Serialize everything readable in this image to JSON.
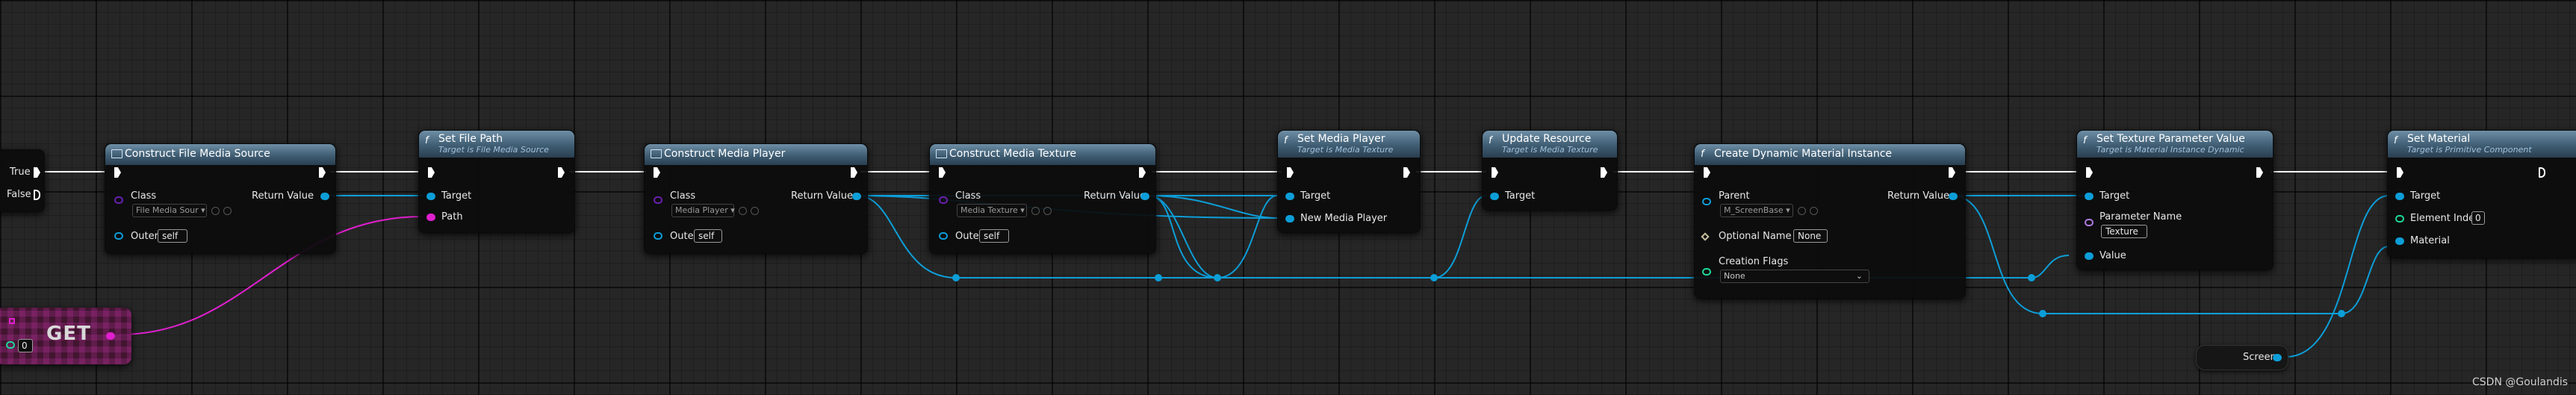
{
  "branch": {
    "true_label": "True",
    "false_label": "False"
  },
  "get_node": {
    "label": "GET",
    "index_value": "0"
  },
  "nodes": {
    "construct_file_media_source": {
      "title": "Construct File Media Source",
      "class_label": "Class",
      "class_value": "File Media Sour",
      "outer_label": "Outer",
      "outer_value": "self",
      "return_label": "Return Value"
    },
    "set_file_path": {
      "title": "Set File Path",
      "subtitle": "Target is File Media Source",
      "target_label": "Target",
      "path_label": "Path"
    },
    "construct_media_player": {
      "title": "Construct Media Player",
      "class_label": "Class",
      "class_value": "Media Player",
      "outer_label": "Outer",
      "outer_value": "self",
      "return_label": "Return Value"
    },
    "construct_media_texture": {
      "title": "Construct Media Texture",
      "class_label": "Class",
      "class_value": "Media Texture",
      "outer_label": "Outer",
      "outer_value": "self",
      "return_label": "Return Value"
    },
    "set_media_player": {
      "title": "Set Media Player",
      "subtitle": "Target is Media Texture",
      "target_label": "Target",
      "new_player_label": "New Media Player"
    },
    "update_resource": {
      "title": "Update Resource",
      "subtitle": "Target is Media Texture",
      "target_label": "Target"
    },
    "create_dmi": {
      "title": "Create Dynamic Material Instance",
      "parent_label": "Parent",
      "parent_value": "M_ScreenBase",
      "optional_name_label": "Optional Name",
      "optional_name_value": "None",
      "creation_flags_label": "Creation Flags",
      "creation_flags_value": "None",
      "return_label": "Return Value"
    },
    "set_texture_param": {
      "title": "Set Texture Parameter Value",
      "subtitle": "Target is Material Instance Dynamic",
      "target_label": "Target",
      "param_name_label": "Parameter Name",
      "param_name_value": "Texture",
      "value_label": "Value"
    },
    "set_material": {
      "title": "Set Material",
      "subtitle": "Target is Primitive Component",
      "target_label": "Target",
      "element_index_label": "Element Index",
      "element_index_value": "0",
      "material_label": "Material"
    }
  },
  "screen_var": {
    "label": "Screen"
  },
  "watermark": "CSDN @Goulandis",
  "colors": {
    "object_pin": "#0d9ed8",
    "string_pin": "#e01fcf",
    "exec_wire": "#ffffff",
    "header": "#3f5d73",
    "int_pin": "#1ed99b",
    "class_pin": "#6a1fb0"
  }
}
